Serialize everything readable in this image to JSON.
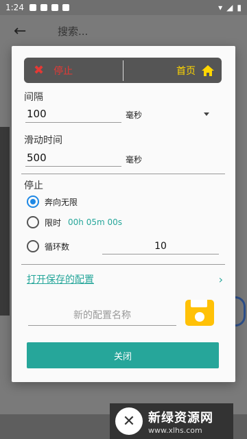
{
  "status_bar": {
    "time": "1:24"
  },
  "background": {
    "search_placeholder": "搜索..."
  },
  "dialog": {
    "top_bar": {
      "stop_label": "停止",
      "home_label": "首页"
    },
    "interval": {
      "label": "间隔",
      "value": "100",
      "unit": "毫秒"
    },
    "swipe_time": {
      "label": "滑动时间",
      "value": "500",
      "unit": "毫秒"
    },
    "stop_section": {
      "label": "停止",
      "options": [
        {
          "label": "奔向无限",
          "checked": true
        },
        {
          "label": "限时",
          "value": "00h 05m 00s",
          "checked": false
        },
        {
          "label": "循环数",
          "value": "10",
          "checked": false
        }
      ]
    },
    "open_saved_label": "打开保存的配置",
    "config_name_placeholder": "新的配置名称",
    "close_label": "关闭"
  },
  "watermark": {
    "title": "新绿资源网",
    "url": "www.xlhs.com"
  },
  "colors": {
    "accent": "#26a69a",
    "stop": "#e53935",
    "home": "#ffd600",
    "save": "#ffc107",
    "radio": "#1e88e5"
  }
}
